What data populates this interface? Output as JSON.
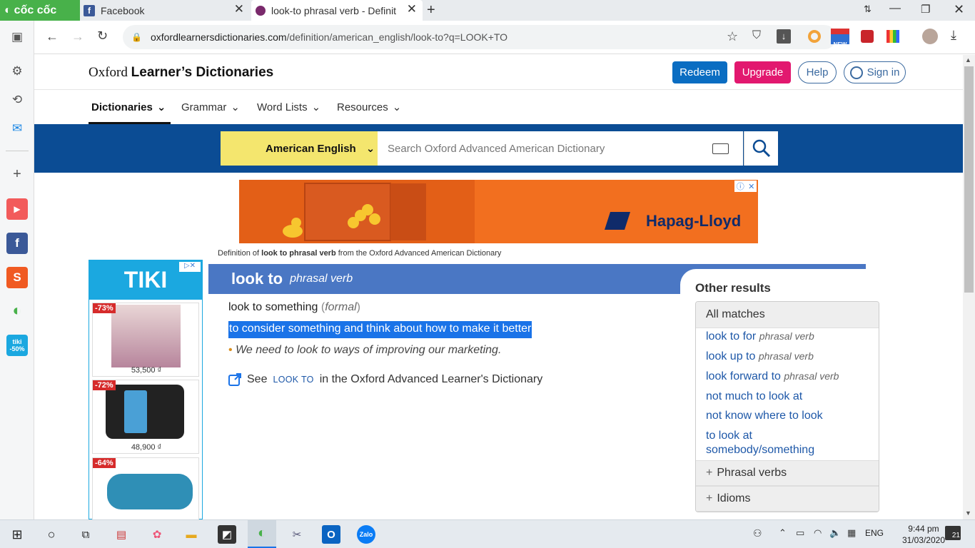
{
  "browser": {
    "brand": "cốc cốc",
    "tabs": [
      {
        "label": "Facebook"
      },
      {
        "label": "look-to phrasal verb - Definit"
      }
    ],
    "url_host": "oxfordlearnersdictionaries.com",
    "url_path": "/definition/american_english/look-to?q=LOOK+TO",
    "new_badge": "NEW"
  },
  "sidebar": {
    "tiki_badge": "tiki -50%"
  },
  "site": {
    "logo_light": "Oxford",
    "logo_bold": "Learner’s Dictionaries",
    "redeem": "Redeem",
    "upgrade": "Upgrade",
    "help": "Help",
    "signin": "Sign in",
    "nav": [
      "Dictionaries",
      "Grammar",
      "Word Lists",
      "Resources"
    ],
    "dictionary_select": "American English",
    "search_placeholder": "Search Oxford Advanced American Dictionary"
  },
  "ad": {
    "brand": "Hapag-Lloyd"
  },
  "tiki_ad": {
    "logo": "TIKI",
    "items": [
      {
        "discount": "-73%",
        "price": "53,500 ₫"
      },
      {
        "discount": "-72%",
        "price": "48,900 ₫"
      },
      {
        "discount": "-64%",
        "price": ""
      }
    ]
  },
  "entry": {
    "source_prefix": "Definition of ",
    "source_term": "look to phrasal verb",
    "source_suffix": " from the Oxford Advanced American Dictionary",
    "headword": "look to",
    "pos": "phrasal verb",
    "sense_head": "look to something",
    "register": "formal",
    "definition": "to consider something and think about how to make it better",
    "example": "We need to look to ways of improving our marketing.",
    "see_prefix": "See",
    "see_term": "look to",
    "see_suffix": "in the Oxford Advanced Learner's Dictionary"
  },
  "other_results": {
    "title": "Other results",
    "all_matches": "All matches",
    "links": [
      {
        "text": "look to for",
        "pos": "phrasal verb"
      },
      {
        "text": "look up to",
        "pos": "phrasal verb"
      },
      {
        "text": "look forward to",
        "pos": "phrasal verb"
      },
      {
        "text": "not much to look at",
        "pos": ""
      },
      {
        "text": "not know where to look",
        "pos": ""
      },
      {
        "text": "to look at somebody/something",
        "pos": ""
      }
    ],
    "phrasal_verbs": "Phrasal verbs",
    "idioms": "Idioms"
  },
  "taskbar": {
    "lang": "ENG",
    "time": "9:44 pm",
    "date": "31/03/2020",
    "notifications": "21"
  }
}
